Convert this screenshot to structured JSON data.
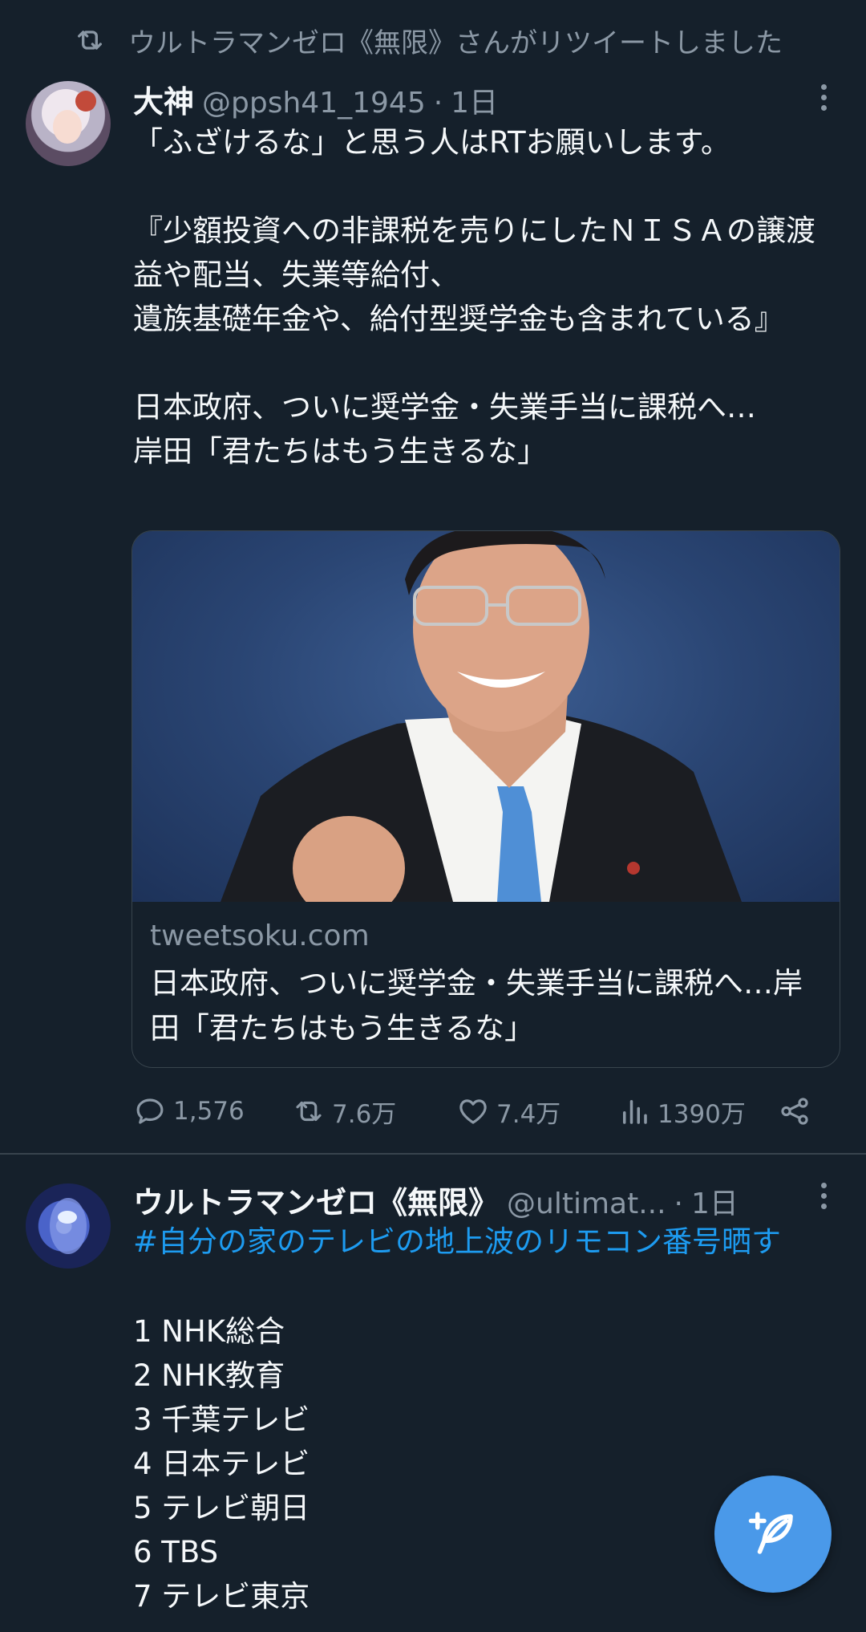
{
  "retweet_notice": "ウルトラマンゼロ《無限》さんがリツイートしました",
  "tweet1": {
    "name": "大神",
    "handle": "@ppsh41_1945",
    "sep": "·",
    "time": "1日",
    "body": "「ふざけるな」と思う人はRTお願いします。\n\n『少額投資への非課税を売りにしたＮＩＳＡの譲渡益や配当、失業等給付、\n遺族基礎年金や、給付型奨学金も含まれている』\n\n日本政府、ついに奨学金・失業手当に課税へ…\n岸田「君たちはもう生きるな」",
    "card": {
      "domain": "tweetsoku.com",
      "title": "日本政府、ついに奨学金・失業手当に課税へ…岸田「君たちはもう生きるな」"
    },
    "actions": {
      "replies": "1,576",
      "retweets": "7.6万",
      "likes": "7.4万",
      "views": "1390万"
    }
  },
  "tweet2": {
    "name": "ウルトラマンゼロ《無限》",
    "handle": "@ultimat...",
    "sep": "·",
    "time": "1日",
    "hashtag": "#自分の家のテレビの地上波のリモコン番号晒す",
    "channels": [
      "1 NHK総合",
      "2 NHK教育",
      "3 千葉テレビ",
      "4 日本テレビ",
      "5 テレビ朝日",
      "6 TBS",
      "7 テレビ東京"
    ]
  },
  "colors": {
    "background": "#15202b",
    "secondary_text": "#8b98a5",
    "accent": "#1d9bf0",
    "fab": "#4a99e9"
  }
}
